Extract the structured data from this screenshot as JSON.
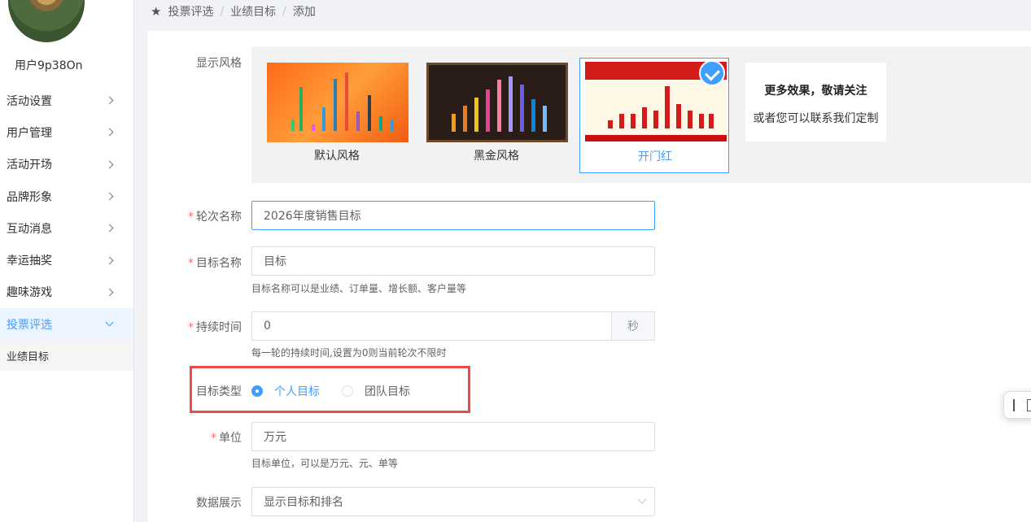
{
  "sidebar": {
    "username": "用户9p38On",
    "items": [
      {
        "label": "活动设置"
      },
      {
        "label": "用户管理"
      },
      {
        "label": "活动开场"
      },
      {
        "label": "品牌形象"
      },
      {
        "label": "互动消息"
      },
      {
        "label": "幸运抽奖"
      },
      {
        "label": "趣味游戏"
      },
      {
        "label": "投票评选"
      }
    ],
    "active_sub": "业绩目标"
  },
  "breadcrumb": [
    "投票评选",
    "业绩目标",
    "添加"
  ],
  "form": {
    "style_label": "显示风格",
    "styles": [
      {
        "name": "默认风格",
        "selected": false
      },
      {
        "name": "黑金风格",
        "selected": false
      },
      {
        "name": "开门红",
        "selected": true
      }
    ],
    "more_title": "更多效果，敬请关注",
    "more_sub": "或者您可以联系我们定制",
    "round_label": "轮次名称",
    "round_value": "2026年度销售目标",
    "target_label": "目标名称",
    "target_value": "目标",
    "target_hint": "目标名称可以是业绩、订单量、增长额、客户量等",
    "duration_label": "持续时间",
    "duration_value": "0",
    "duration_unit": "秒",
    "duration_hint": "每一轮的持续时间,设置为0则当前轮次不限时",
    "type_label": "目标类型",
    "type_options": [
      "个人目标",
      "团队目标"
    ],
    "type_selected": "个人目标",
    "unit_label": "单位",
    "unit_value": "万元",
    "unit_hint": "目标单位，可以是万元、元、单等",
    "display_label": "数据展示",
    "display_value": "显示目标和排名"
  },
  "colors": {
    "accent": "#409eff",
    "required": "#f56c6c",
    "highlight": "#e94b4b"
  }
}
